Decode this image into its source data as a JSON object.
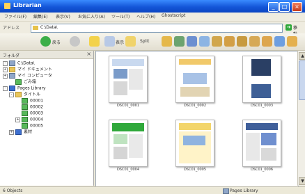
{
  "window": {
    "title": "Librarian",
    "min": "_",
    "max": "□",
    "close": "×"
  },
  "menu": [
    "ファイル(F)",
    "編集(E)",
    "表示(V)",
    "お気に入り(A)",
    "ツール(T)",
    "ヘルプ(H)",
    "Ghostscript"
  ],
  "address": {
    "label": "アドレス",
    "value": "C:\\Data\\",
    "go": "移動"
  },
  "toolbar": {
    "back": "戻る",
    "view_label": "表示",
    "layout_label": "Split"
  },
  "tree": {
    "header": "フォルダ",
    "items": [
      {
        "label": "C:\\Data\\",
        "icon": "drive",
        "expander": "-",
        "indent": 0
      },
      {
        "label": "マイ ドキュメント",
        "icon": "folder",
        "expander": "+",
        "indent": 0
      },
      {
        "label": "マイ コンピュータ",
        "icon": "drive",
        "expander": "+",
        "indent": 0
      },
      {
        "label": "ごみ箱",
        "icon": "green",
        "expander": "",
        "indent": 1
      },
      {
        "label": "Pages Library",
        "icon": "blue",
        "expander": "-",
        "indent": 0
      },
      {
        "label": "タイトル",
        "icon": "folder",
        "expander": "-",
        "indent": 1
      },
      {
        "label": "00001",
        "icon": "green",
        "expander": "",
        "indent": 2
      },
      {
        "label": "00002",
        "icon": "green",
        "expander": "",
        "indent": 2
      },
      {
        "label": "00003",
        "icon": "green",
        "expander": "",
        "indent": 2
      },
      {
        "label": "00004",
        "icon": "green",
        "expander": "+",
        "indent": 2
      },
      {
        "label": "00005",
        "icon": "green",
        "expander": "",
        "indent": 2
      },
      {
        "label": "素材",
        "icon": "blue",
        "expander": "+",
        "indent": 1
      }
    ]
  },
  "thumbnails": [
    {
      "name": "DSC01_0001"
    },
    {
      "name": "DSC01_0002"
    },
    {
      "name": "DSC01_0003"
    },
    {
      "name": "DSC01_0004"
    },
    {
      "name": "DSC01_0005"
    },
    {
      "name": "DSC01_0006"
    }
  ],
  "status": {
    "left": "6 Objects",
    "right": "Pages Library"
  },
  "colors": {
    "titlebar": "#1456d8",
    "green": "#2fa83a",
    "folder": "#e8c55a"
  }
}
